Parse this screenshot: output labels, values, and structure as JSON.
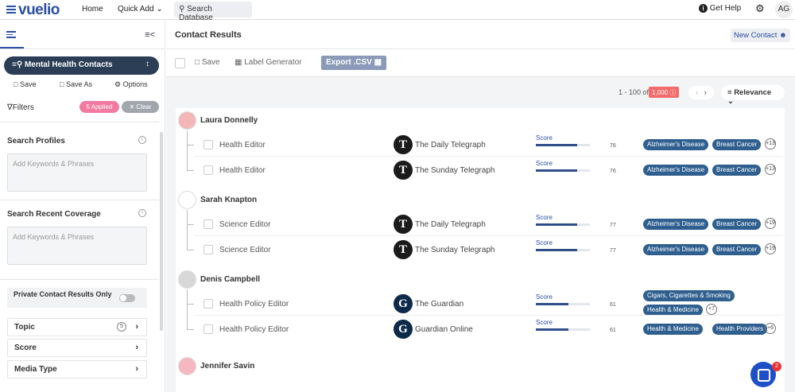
{
  "topbar": {
    "logo": "vuelio",
    "home": "Home",
    "quick_add": "Quick Add",
    "search_db": "Search Database",
    "get_help": "Get Help",
    "user_initials": "AG"
  },
  "sidebar": {
    "saved_search": "Mental Health Contacts",
    "save": "Save",
    "save_as": "Save As",
    "options": "Options",
    "filters": "Filters",
    "applied": "5 Applied",
    "clear": "Clear",
    "search_profiles": "Search Profiles",
    "search_profiles_placeholder": "Add Keywords & Phrases",
    "search_coverage": "Search Recent Coverage",
    "search_coverage_placeholder": "Add Keywords & Phrases",
    "private_label": "Private Contact Results Only",
    "accordions": [
      {
        "label": "Topic",
        "count": "5"
      },
      {
        "label": "Score",
        "count": ""
      },
      {
        "label": "Media Type",
        "count": ""
      }
    ]
  },
  "main": {
    "title": "Contact Results",
    "new_contact": "New Contact",
    "toolbar": {
      "save": "Save",
      "label_gen": "Label Generator",
      "export": "Export .CSV"
    },
    "pager": {
      "range": "1 - 100 of",
      "total": "1,000",
      "sort": "Relevance"
    },
    "score_label": "Score"
  },
  "contacts": [
    {
      "name": "Laura Donnelly",
      "rows": [
        {
          "role": "Health Editor",
          "outlet": "The Daily Telegraph",
          "logo": "T",
          "score": "76",
          "tags": [
            "Alzheimer's Disease",
            "Breast Cancer"
          ],
          "more": "+13"
        },
        {
          "role": "Health Editor",
          "outlet": "The Sunday Telegraph",
          "logo": "T",
          "score": "76",
          "tags": [
            "Alzheimer's Disease",
            "Breast Cancer"
          ],
          "more": "+13"
        }
      ]
    },
    {
      "name": "Sarah Knapton",
      "rows": [
        {
          "role": "Science Editor",
          "outlet": "The Daily Telegraph",
          "logo": "T",
          "score": "77",
          "tags": [
            "Alzheimer's Disease",
            "Breast Cancer"
          ],
          "more": "+19"
        },
        {
          "role": "Science Editor",
          "outlet": "The Sunday Telegraph",
          "logo": "T",
          "score": "77",
          "tags": [
            "Alzheimer's Disease",
            "Breast Cancer"
          ],
          "more": "+19"
        }
      ]
    },
    {
      "name": "Denis Campbell",
      "rows": [
        {
          "role": "Health Policy Editor",
          "outlet": "The Guardian",
          "logo": "G",
          "score": "61",
          "tags": [
            "Cigars, Cigarettes & Smoking",
            "Health & Medicine"
          ],
          "more": "+7"
        },
        {
          "role": "Health Policy Editor",
          "outlet": "Guardian Online",
          "logo": "G",
          "score": "61",
          "tags": [
            "Health & Medicine",
            "Health Providers"
          ],
          "more": "+6"
        }
      ]
    },
    {
      "name": "Jennifer Savin",
      "rows": []
    }
  ],
  "chat_badge": "2"
}
